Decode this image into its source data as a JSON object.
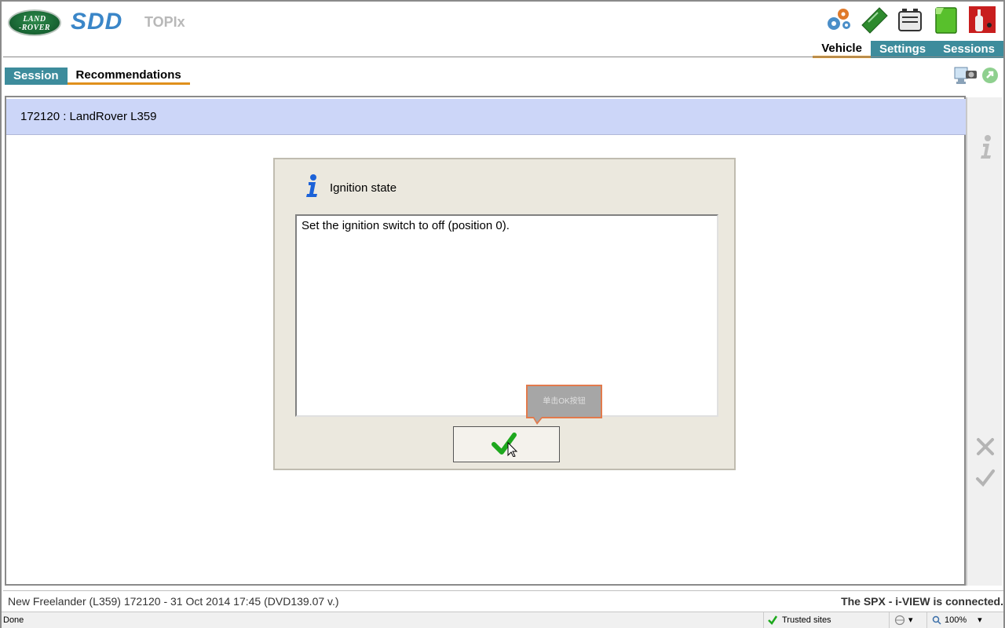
{
  "header": {
    "brand_logo_text": "LAND-ROVER",
    "app_logo": "SDD",
    "product_name": "TOPIx",
    "top_icons": [
      "settings-gears-icon",
      "ticket-icon",
      "battery-icon",
      "green-box-icon",
      "red-device-icon"
    ],
    "main_tabs": [
      {
        "label": "Vehicle",
        "active": true
      },
      {
        "label": "Settings",
        "active": false
      },
      {
        "label": "Sessions",
        "active": false
      }
    ]
  },
  "sub_tabs": [
    {
      "label": "Session",
      "active": true
    },
    {
      "label": "Recommendations",
      "active": false
    }
  ],
  "vehicle_bar": {
    "label": "172120 : LandRover L359"
  },
  "dialog": {
    "title": "Ignition state",
    "message": "Set the ignition switch to off (position 0)."
  },
  "tooltip": {
    "text": "单击OK按钮"
  },
  "footer": {
    "left": "New Freelander (L359) 172120 - 31 Oct 2014 17:45 (DVD139.07 v.)",
    "right": "The SPX - i-VIEW is connected."
  },
  "statusbar": {
    "status": "Done",
    "zone": "Trusted sites",
    "zoom": "100%"
  },
  "colors": {
    "tab_teal": "#3d8c9c",
    "tab_underline": "#e0901c",
    "vehicle_bar": "#ccd6f8",
    "dialog_bg": "#ebe8de",
    "tooltip_border": "#e27a4c"
  }
}
